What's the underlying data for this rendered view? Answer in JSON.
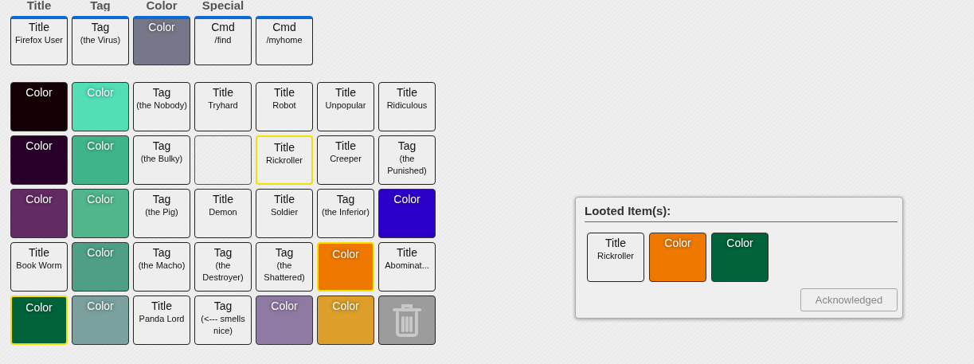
{
  "headers": [
    "Title",
    "Tag",
    "Color",
    "Special"
  ],
  "hotbar": [
    {
      "kind": "title",
      "label": "Title",
      "text": "Firefox User"
    },
    {
      "kind": "tag",
      "label": "Tag",
      "text": "(the Virus)"
    },
    {
      "kind": "color",
      "label": "Color",
      "color": "#767889"
    },
    {
      "kind": "cmd",
      "label": "Cmd",
      "text": "/find"
    },
    {
      "kind": "cmd",
      "label": "Cmd",
      "text": "/myhome"
    }
  ],
  "inventory": [
    {
      "kind": "color",
      "label": "Color",
      "color": "#150005",
      "selected": false
    },
    {
      "kind": "color",
      "label": "Color",
      "color": "#52dfb6",
      "selected": false
    },
    {
      "kind": "tag",
      "label": "Tag",
      "text": "(the Nobody)",
      "selected": false
    },
    {
      "kind": "title",
      "label": "Title",
      "text": "Tryhard",
      "selected": false
    },
    {
      "kind": "title",
      "label": "Title",
      "text": "Robot",
      "selected": false
    },
    {
      "kind": "title",
      "label": "Title",
      "text": "Unpopular",
      "selected": false
    },
    {
      "kind": "title",
      "label": "Title",
      "text": "Ridiculous",
      "selected": false
    },
    {
      "kind": "color",
      "label": "Color",
      "color": "#28002a",
      "selected": false
    },
    {
      "kind": "color",
      "label": "Color",
      "color": "#40b48b",
      "selected": false
    },
    {
      "kind": "tag",
      "label": "Tag",
      "text": "(the Bulky)",
      "selected": false
    },
    {
      "kind": "empty",
      "selected": false
    },
    {
      "kind": "title",
      "label": "Title",
      "text": "Rickroller",
      "selected": true
    },
    {
      "kind": "title",
      "label": "Title",
      "text": "Creeper",
      "selected": false
    },
    {
      "kind": "tag",
      "label": "Tag",
      "text": "(the Punished)",
      "selected": false
    },
    {
      "kind": "color",
      "label": "Color",
      "color": "#632a63",
      "selected": false
    },
    {
      "kind": "color",
      "label": "Color",
      "color": "#51b68b",
      "selected": false
    },
    {
      "kind": "tag",
      "label": "Tag",
      "text": "(the Pig)",
      "selected": false
    },
    {
      "kind": "title",
      "label": "Title",
      "text": "Demon",
      "selected": false
    },
    {
      "kind": "title",
      "label": "Title",
      "text": "Soldier",
      "selected": false
    },
    {
      "kind": "tag",
      "label": "Tag",
      "text": "(the Inferior)",
      "selected": false
    },
    {
      "kind": "color",
      "label": "Color",
      "color": "#2c00c8",
      "selected": false
    },
    {
      "kind": "title",
      "label": "Title",
      "text": "Book Worm",
      "selected": false
    },
    {
      "kind": "color",
      "label": "Color",
      "color": "#4f9f88",
      "selected": false
    },
    {
      "kind": "tag",
      "label": "Tag",
      "text": "(the Macho)",
      "selected": false
    },
    {
      "kind": "tag",
      "label": "Tag",
      "text": "(the Destroyer)",
      "selected": false
    },
    {
      "kind": "tag",
      "label": "Tag",
      "text": "(the Shattered)",
      "selected": false
    },
    {
      "kind": "color",
      "label": "Color",
      "color": "#ef7900",
      "selected": true
    },
    {
      "kind": "title",
      "label": "Title",
      "text": "Abominat...",
      "selected": false
    },
    {
      "kind": "color",
      "label": "Color",
      "color": "#00633a",
      "selected": true
    },
    {
      "kind": "color",
      "label": "Color",
      "color": "#7aa19d",
      "selected": false
    },
    {
      "kind": "title",
      "label": "Title",
      "text": "Panda Lord",
      "selected": false
    },
    {
      "kind": "tag",
      "label": "Tag",
      "text": "(<--- smells nice)",
      "selected": false
    },
    {
      "kind": "color",
      "label": "Color",
      "color": "#8f7aa3",
      "selected": false
    },
    {
      "kind": "color",
      "label": "Color",
      "color": "#dd9f2a",
      "selected": false
    },
    {
      "kind": "trash",
      "selected": false
    }
  ],
  "loot_dialog": {
    "title": "Looted Item(s):",
    "items": [
      {
        "kind": "title",
        "label": "Title",
        "text": "Rickroller"
      },
      {
        "kind": "color",
        "label": "Color",
        "color": "#ef7900"
      },
      {
        "kind": "color",
        "label": "Color",
        "color": "#00633a"
      }
    ],
    "button": {
      "label": "Acknowledged",
      "disabled": true
    }
  }
}
